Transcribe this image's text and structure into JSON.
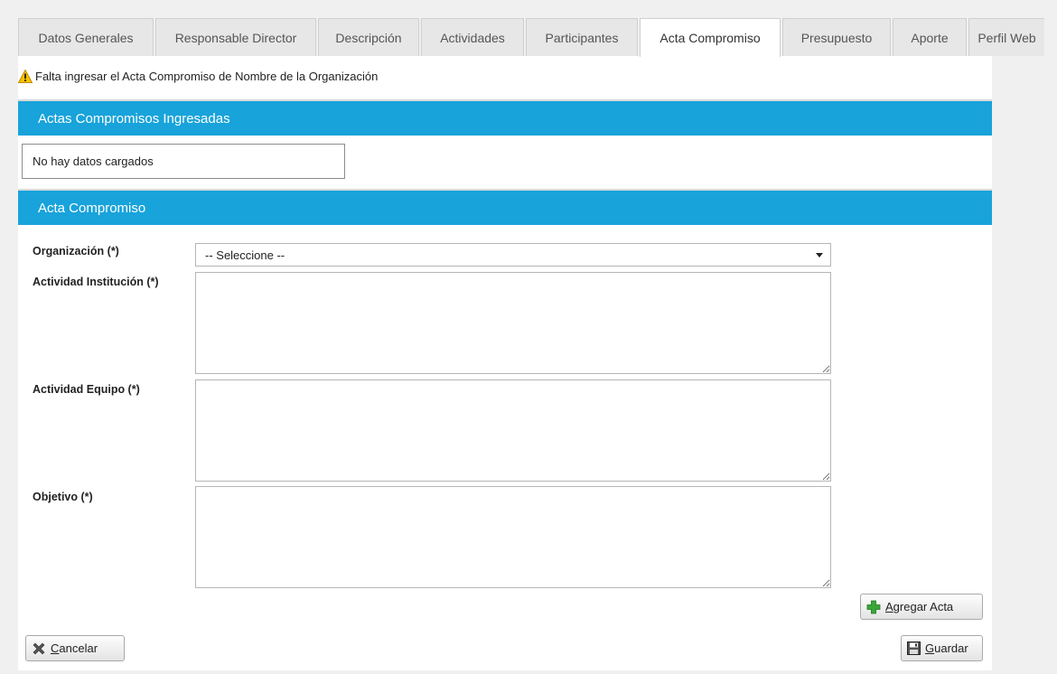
{
  "tabs": [
    {
      "label": "Datos Generales",
      "active": false
    },
    {
      "label": "Responsable Director",
      "active": false
    },
    {
      "label": "Descripción",
      "active": false
    },
    {
      "label": "Actividades",
      "active": false
    },
    {
      "label": "Participantes",
      "active": false
    },
    {
      "label": "Acta Compromiso",
      "active": true
    },
    {
      "label": "Presupuesto",
      "active": false
    },
    {
      "label": "Aporte",
      "active": false
    },
    {
      "label": "Perfil Web",
      "active": false
    }
  ],
  "warning": {
    "icon": "warning-icon",
    "text": "Falta ingresar el Acta Compromiso de Nombre de la Organización"
  },
  "actas_ingresadas": {
    "title": "Actas Compromisos Ingresadas",
    "empty_text": "No hay datos cargados"
  },
  "acta_form": {
    "title": "Acta Compromiso",
    "organizacion_label": "Organización (*)",
    "organizacion_value": "-- Seleccione --",
    "actividad_institucion_label": "Actividad Institución (*)",
    "actividad_equipo_label": "Actividad Equipo (*)",
    "objetivo_label": "Objetivo (*)"
  },
  "buttons": {
    "agregar": {
      "accel": "A",
      "rest": "gregar Acta",
      "icon": "plus-icon"
    },
    "cancelar": {
      "accel": "C",
      "rest": "ancelar",
      "icon": "x-icon"
    },
    "guardar": {
      "accel": "G",
      "rest": "uardar",
      "icon": "save-icon"
    }
  },
  "colors": {
    "section_header": "#18a3db",
    "plus_icon": "#3aa63a",
    "warning_icon": "#f5c400"
  }
}
